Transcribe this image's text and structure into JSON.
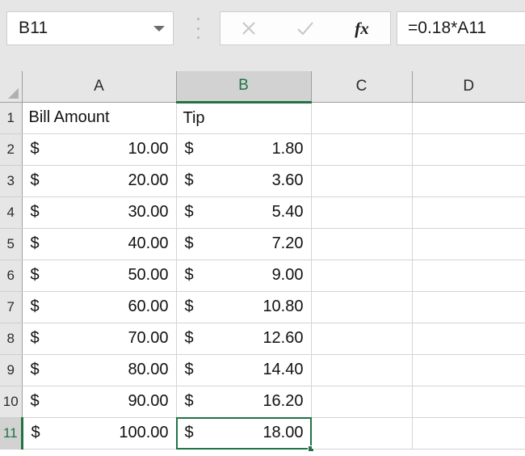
{
  "formula_bar": {
    "name_box_value": "B11",
    "name_box_dropdown_icon": "chevron-down-icon",
    "grip_icon": "vertical-dots-grip-icon",
    "cancel_icon": "cancel-x-icon",
    "enter_icon": "checkmark-icon",
    "insert_function_icon": "fx-icon",
    "insert_function_label": "fx",
    "formula_value": "=0.18*A11"
  },
  "grid": {
    "select_all_icon": "select-all-triangle-icon",
    "column_headers": [
      "A",
      "B",
      "C",
      "D"
    ],
    "active_column": "B",
    "row_headers": [
      "1",
      "2",
      "3",
      "4",
      "5",
      "6",
      "7",
      "8",
      "9",
      "10",
      "11"
    ],
    "active_row": "11",
    "selected_cell": "B11",
    "currency_symbol": "$",
    "rows": [
      {
        "row": "1",
        "a_text": "Bill Amount",
        "b_text": "Tip"
      },
      {
        "row": "2",
        "a_value": "10.00",
        "b_value": "1.80"
      },
      {
        "row": "3",
        "a_value": "20.00",
        "b_value": "3.60"
      },
      {
        "row": "4",
        "a_value": "30.00",
        "b_value": "5.40"
      },
      {
        "row": "5",
        "a_value": "40.00",
        "b_value": "7.20"
      },
      {
        "row": "6",
        "a_value": "50.00",
        "b_value": "9.00"
      },
      {
        "row": "7",
        "a_value": "60.00",
        "b_value": "10.80"
      },
      {
        "row": "8",
        "a_value": "70.00",
        "b_value": "12.60"
      },
      {
        "row": "9",
        "a_value": "80.00",
        "b_value": "14.40"
      },
      {
        "row": "10",
        "a_value": "90.00",
        "b_value": "16.20"
      },
      {
        "row": "11",
        "a_value": "100.00",
        "b_value": "18.00"
      }
    ]
  },
  "colors": {
    "excel_green": "#217346",
    "header_gray": "#e6e6e6",
    "active_header_gray": "#d2d2d2",
    "gridline": "#d4d4d4"
  }
}
